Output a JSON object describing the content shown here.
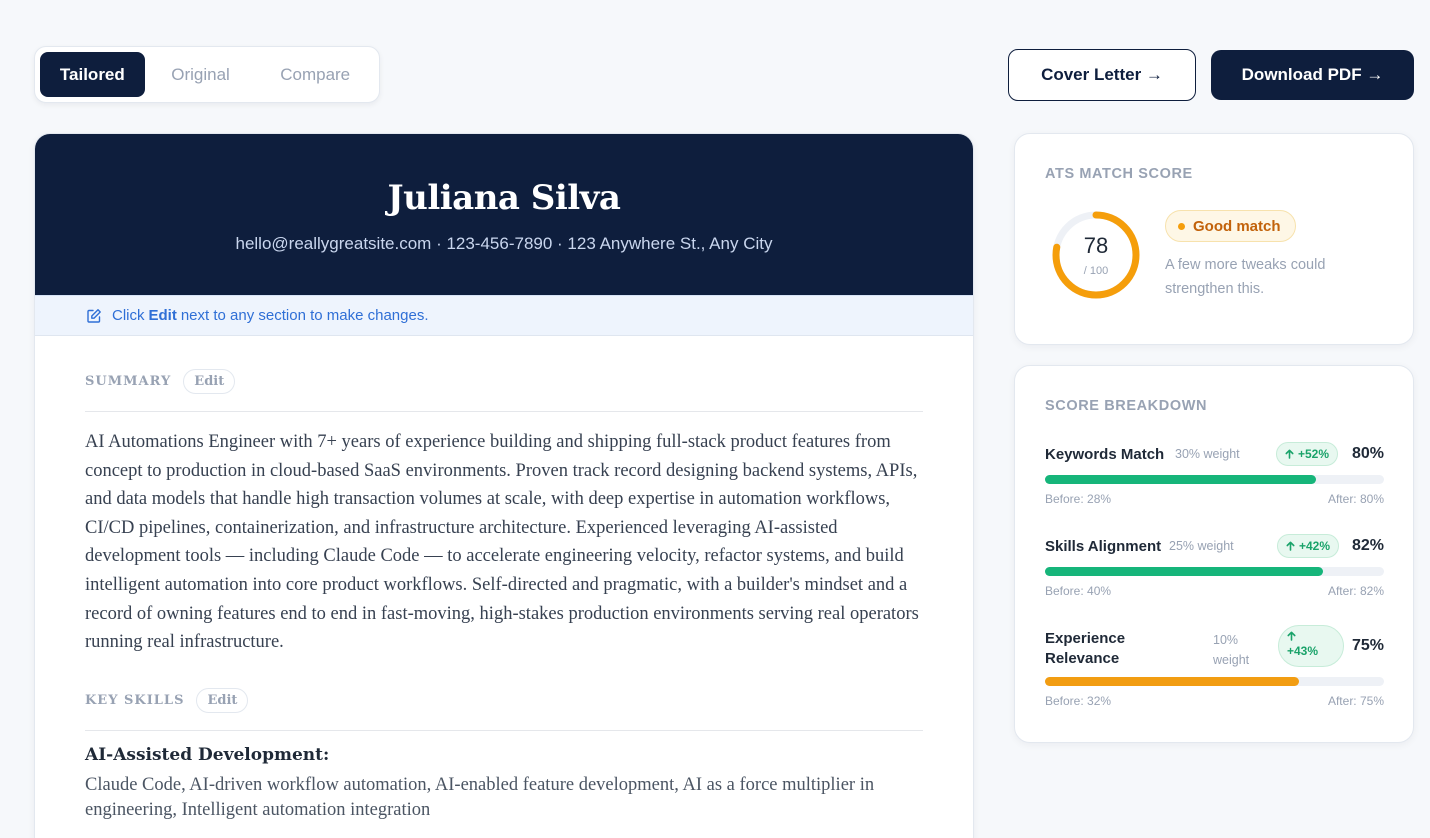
{
  "tabs": [
    {
      "label": "Tailored",
      "active": true
    },
    {
      "label": "Original",
      "active": false
    },
    {
      "label": "Compare",
      "active": false
    }
  ],
  "actions": {
    "cover_letter": "Cover Letter →",
    "download_pdf": "Download PDF →"
  },
  "resume": {
    "name": "Juliana Silva",
    "contact": "hello@reallygreatsite.com · 123-456-7890 · 123 Anywhere St., Any City",
    "hint": {
      "prefix": "Click",
      "strong": "Edit",
      "suffix": "next to any section to make changes."
    },
    "summary": {
      "title": "SUMMARY",
      "edit_label": "Edit",
      "text": "AI Automations Engineer with 7+ years of experience building and shipping full-stack product features from concept to production in cloud-based SaaS environments. Proven track record designing backend systems, APIs, and data models that handle high transaction volumes at scale, with deep expertise in automation workflows, CI/CD pipelines, containerization, and infrastructure architecture. Experienced leveraging AI-assisted development tools — including Claude Code — to accelerate engineering velocity, refactor systems, and build intelligent automation into core product workflows. Self-directed and pragmatic, with a builder's mindset and a record of owning features end to end in fast-moving, high-stakes production environments serving real operators running real infrastructure."
    },
    "skills": {
      "title": "KEY SKILLS",
      "edit_label": "Edit",
      "categories": [
        {
          "name": "AI-Assisted Development:",
          "items": "Claude Code, AI-driven workflow automation, AI-enabled feature development, AI as a force multiplier in engineering, Intelligent automation integration"
        }
      ]
    }
  },
  "ats": {
    "label": "ATS MATCH SCORE",
    "score": "78",
    "score_value": 78,
    "max": "/ 100",
    "badge": "Good match",
    "description": "A few more tweaks could strengthen this.",
    "gauge_color": "#f59e0b"
  },
  "breakdown": {
    "label": "SCORE BREAKDOWN",
    "metrics": [
      {
        "name": "Keywords Match",
        "weight": "30% weight",
        "delta": "+52%",
        "pct": "80%",
        "after_value": 80,
        "before": "Before: 28%",
        "after": "After: 80%",
        "color": "#16b57a"
      },
      {
        "name": "Skills Alignment",
        "weight": "25% weight",
        "delta": "+42%",
        "pct": "82%",
        "after_value": 82,
        "before": "Before: 40%",
        "after": "After: 82%",
        "color": "#16b57a"
      },
      {
        "name": "Experience Relevance",
        "weight": "10% weight",
        "delta": "+43%",
        "pct": "75%",
        "after_value": 75,
        "before": "Before: 32%",
        "after": "After: 75%",
        "color": "#f29d12"
      }
    ]
  }
}
